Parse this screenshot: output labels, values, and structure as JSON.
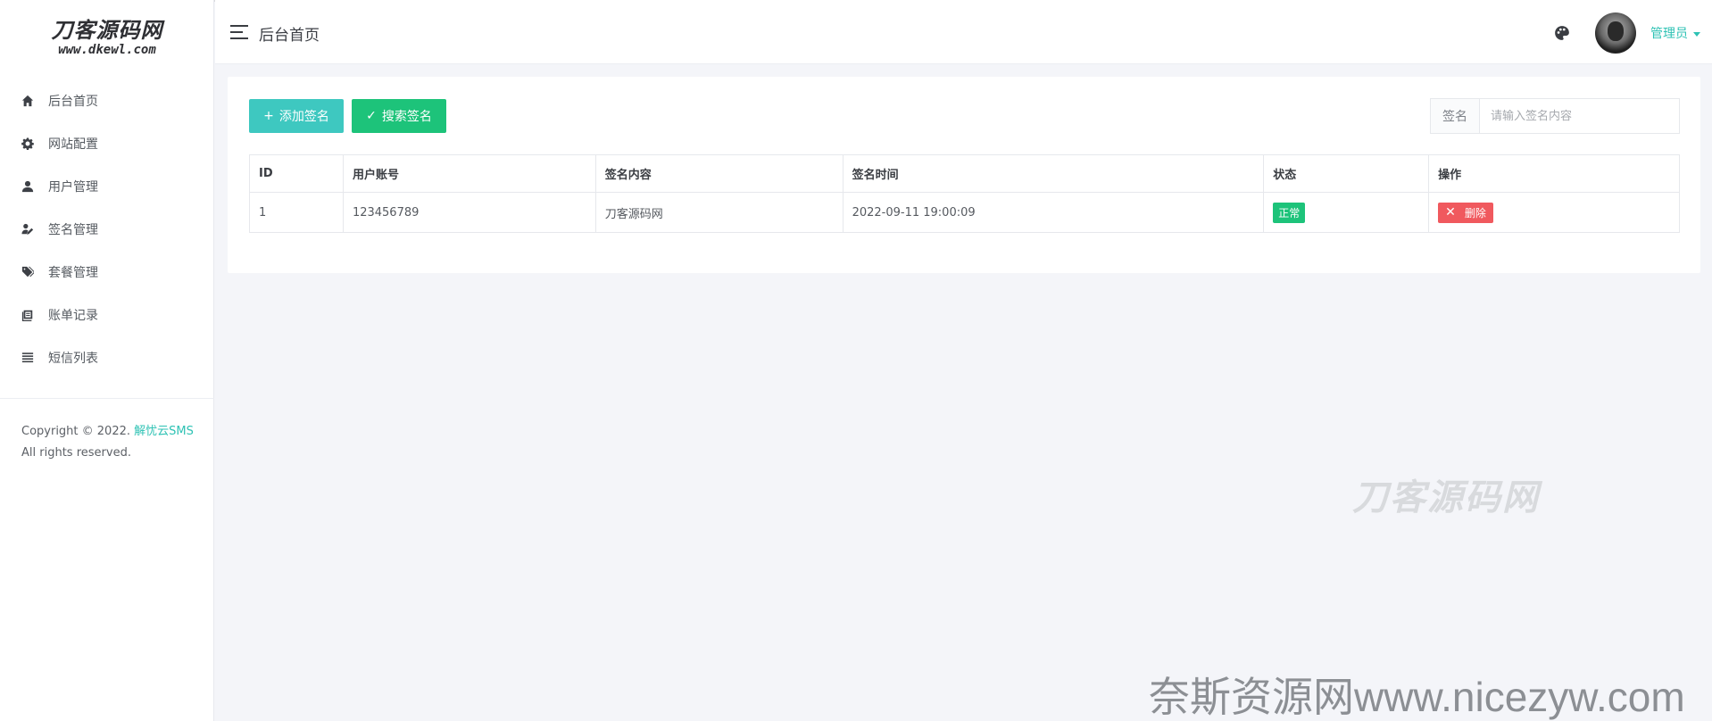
{
  "sidebar": {
    "logo_main": "刀客源码网",
    "logo_sub": "www.dkewl.com",
    "items": [
      {
        "label": "后台首页",
        "icon": "home-icon"
      },
      {
        "label": "网站配置",
        "icon": "gear-icon"
      },
      {
        "label": "用户管理",
        "icon": "user-icon"
      },
      {
        "label": "签名管理",
        "icon": "signature-icon"
      },
      {
        "label": "套餐管理",
        "icon": "tags-icon"
      },
      {
        "label": "账单记录",
        "icon": "book-icon"
      },
      {
        "label": "短信列表",
        "icon": "list-icon"
      }
    ],
    "copyright": {
      "prefix": "Copyright © 2022.",
      "brand": "解忧云SMS",
      "suffix": "All rights reserved."
    }
  },
  "header": {
    "title": "后台首页",
    "user_name": "管理员",
    "palette_icon": "palette-icon",
    "menu_icon": "menu-toggle-icon"
  },
  "toolbar": {
    "add_label": "添加签名",
    "search_label": "搜索签名",
    "field_label": "签名",
    "field_placeholder": "请输入签名内容"
  },
  "table": {
    "headers": [
      "ID",
      "用户账号",
      "签名内容",
      "签名时间",
      "状态",
      "操作"
    ],
    "rows": [
      {
        "id": "1",
        "account": "123456789",
        "content": "刀客源码网",
        "time": "2022-09-11 19:00:09",
        "status": "正常",
        "action": "删除"
      }
    ]
  },
  "watermarks": {
    "logo": "刀客源码网",
    "site": "奈斯资源网www.nicezyw.com"
  },
  "colors": {
    "accent": "#2ec2b4",
    "add_button": "#3ec8c0",
    "search_button": "#1dc37a",
    "status_ok": "#1dc37a",
    "danger": "#f0595e",
    "background": "#f4f5f9"
  }
}
